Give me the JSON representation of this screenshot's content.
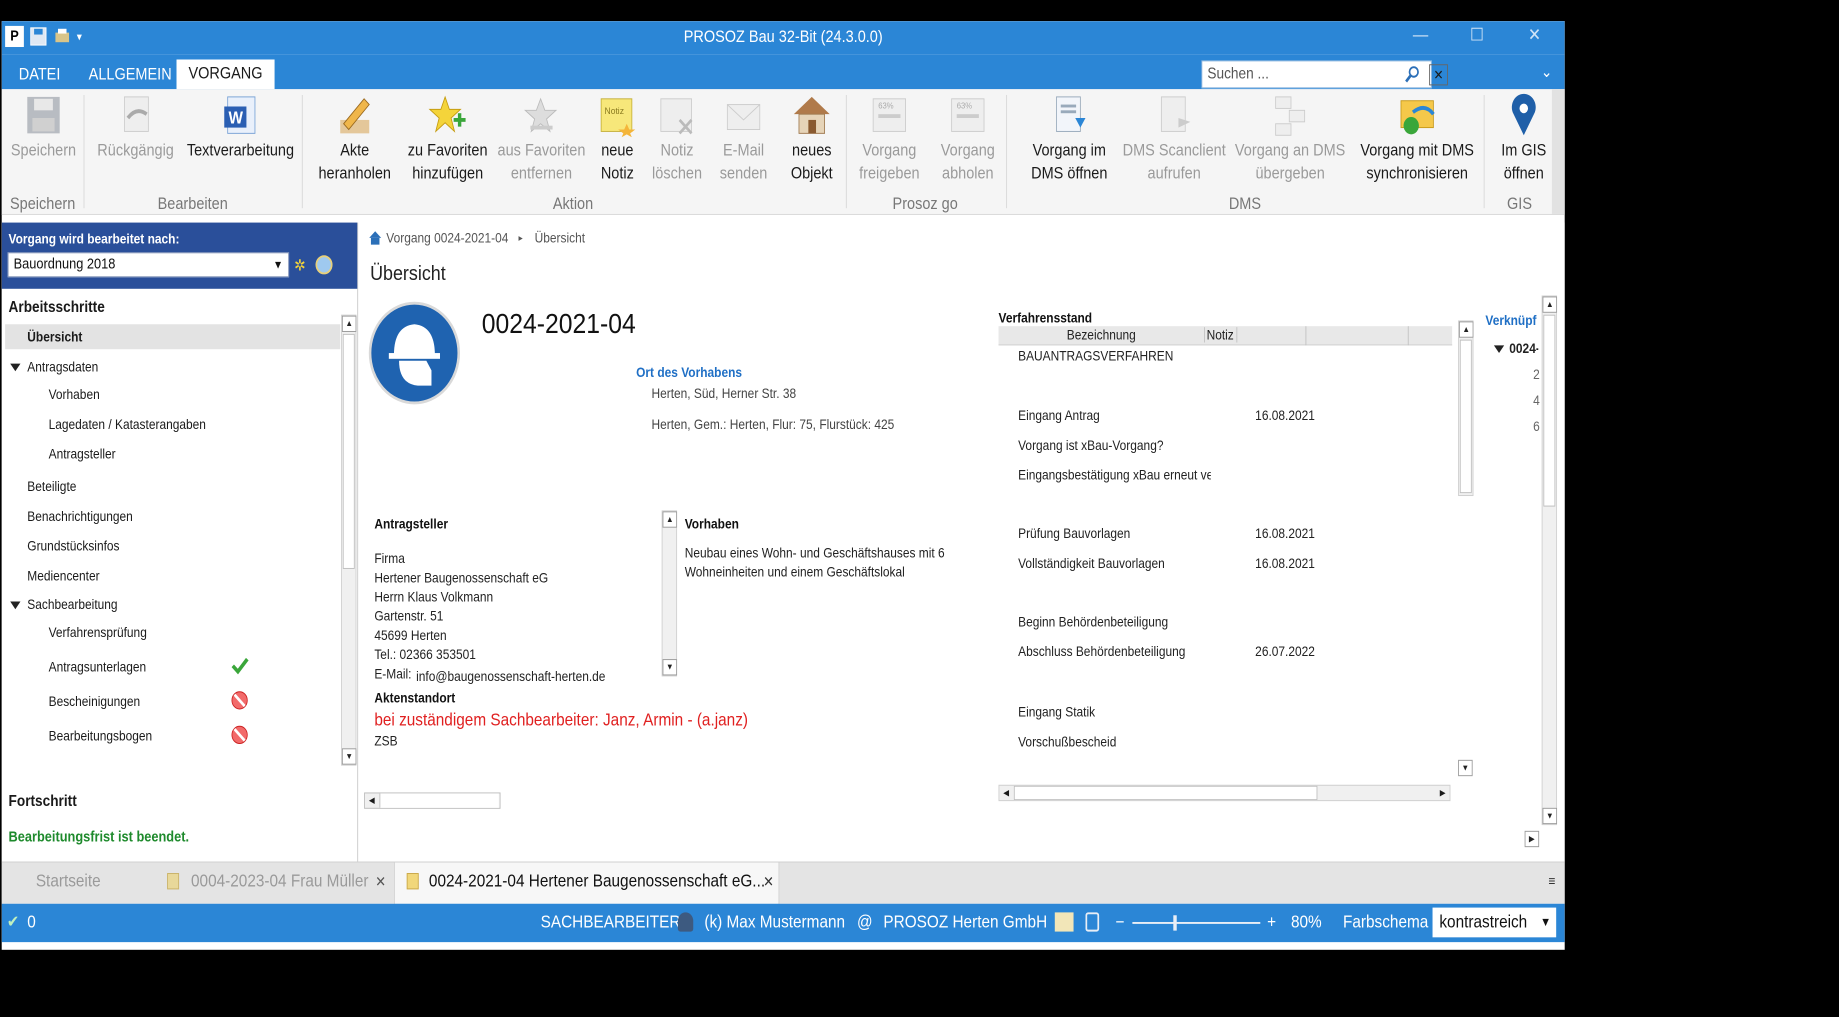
{
  "window": {
    "title": "PROSOZ Bau 32-Bit (24.3.0.0)",
    "app_badge": "P"
  },
  "ribbon_tabs": [
    "DATEI",
    "ALLGEMEIN",
    "VORGANG"
  ],
  "search": {
    "placeholder": "Suchen ..."
  },
  "ribbon": {
    "buttons": [
      {
        "label1": "Speichern",
        "label2": "",
        "icon": "floppy-icon",
        "enabled": false
      },
      {
        "label1": "Rückgängig",
        "label2": "",
        "icon": "undo-icon",
        "enabled": false
      },
      {
        "label1": "Textverarbeitung",
        "label2": "",
        "icon": "word-icon",
        "enabled": true
      },
      {
        "label1": "Akte",
        "label2": "heranholen",
        "icon": "pencil-icon",
        "enabled": true
      },
      {
        "label1": "zu Favoriten",
        "label2": "hinzufügen",
        "icon": "star-add-icon",
        "enabled": true
      },
      {
        "label1": "aus Favoriten",
        "label2": "entfernen",
        "icon": "star-remove-icon",
        "enabled": false
      },
      {
        "label1": "neue",
        "label2": "Notiz",
        "icon": "note-icon",
        "enabled": true
      },
      {
        "label1": "Notiz",
        "label2": "löschen",
        "icon": "note-delete-icon",
        "enabled": false
      },
      {
        "label1": "E-Mail",
        "label2": "senden",
        "icon": "mail-icon",
        "enabled": false
      },
      {
        "label1": "neues",
        "label2": "Objekt",
        "icon": "house-icon",
        "enabled": true
      },
      {
        "label1": "Vorgang",
        "label2": "freigeben",
        "icon": "upload-icon",
        "enabled": false
      },
      {
        "label1": "Vorgang",
        "label2": "abholen",
        "icon": "download-icon",
        "enabled": false
      },
      {
        "label1": "Vorgang im",
        "label2": "DMS öffnen",
        "icon": "dms-open-icon",
        "enabled": true
      },
      {
        "label1": "DMS Scanclient",
        "label2": "aufrufen",
        "icon": "scan-icon",
        "enabled": false
      },
      {
        "label1": "Vorgang an DMS",
        "label2": "übergeben",
        "icon": "dms-transfer-icon",
        "enabled": false
      },
      {
        "label1": "Vorgang mit DMS",
        "label2": "synchronisieren",
        "icon": "sync-icon",
        "enabled": true
      },
      {
        "label1": "Im GIS",
        "label2": "öffnen",
        "icon": "map-pin-icon",
        "enabled": true
      }
    ],
    "groups": [
      "Speichern",
      "Bearbeiten",
      "Aktion",
      "Prosoz go",
      "DMS",
      "GIS"
    ],
    "badge_63": "63%"
  },
  "left": {
    "header": "Vorgang wird bearbeitet nach:",
    "combo_value": "Bauordnung 2018",
    "section_title": "Arbeitsschritte",
    "items": [
      "Übersicht",
      "Antragsdaten",
      "Vorhaben",
      "Lagedaten / Katasterangaben",
      "Antragsteller",
      "Beteiligte",
      "Benachrichtigungen",
      "Grundstücksinfos",
      "Mediencenter",
      "Sachbearbeitung",
      "Verfahrensprüfung",
      "Antragsunterlagen",
      "Bescheinigungen",
      "Bearbeitungsbogen"
    ],
    "progress_title": "Fortschritt",
    "progress_text": "Bearbeitungsfrist ist beendet."
  },
  "main": {
    "breadcrumb": [
      "Vorgang 0024-2021-04",
      "Übersicht"
    ],
    "page_title": "Übersicht",
    "case_number": "0024-2021-04",
    "ort_title": "Ort des Vorhabens",
    "ort_line1": "Herten, Süd, Herner Str. 38",
    "ort_line2": "Herten, Gem.: Herten, Flur: 75, Flurstück: 425",
    "antragsteller_title": "Antragsteller",
    "antragsteller_lines": [
      "Firma",
      "Hertener Baugenossenschaft eG",
      "Herrn Klaus Volkmann",
      "Gartenstr. 51",
      "45699 Herten",
      "Tel.: 02366 353501"
    ],
    "email_label": "E-Mail:",
    "email_value": "info@baugenossenschaft-herten.de",
    "vorhaben_title": "Vorhaben",
    "vorhaben_line1": "Neubau eines Wohn- und Geschäftshauses mit 6",
    "vorhaben_line2": "Wohneinheiten und einem Geschäftslokal",
    "aktenstandort_title": "Aktenstandort",
    "aktenstandort_text": "bei zuständigem Sachbearbeiter: Janz, Armin - (a.janz)",
    "aktenstandort_sub": "ZSB",
    "verfahrensstand": {
      "title": "Verfahrensstand",
      "col_bezeichnung": "Bezeichnung",
      "col_notiz": "Notiz",
      "rows": [
        {
          "name": "BAUANTRAGSVERFAHREN",
          "date": ""
        },
        {
          "name": "Eingang Antrag",
          "date": "16.08.2021"
        },
        {
          "name": "Vorgang ist xBau-Vorgang?",
          "date": ""
        },
        {
          "name": "Eingangsbestätigung xBau erneut ve",
          "date": ""
        },
        {
          "name": "Prüfung  Bauvorlagen",
          "date": "16.08.2021"
        },
        {
          "name": "Vollständigkeit Bauvorlagen",
          "date": "16.08.2021"
        },
        {
          "name": "Beginn Behördenbeteiligung",
          "date": ""
        },
        {
          "name": "Abschluss Behördenbeteiligung",
          "date": "26.07.2022"
        },
        {
          "name": "Eingang Statik",
          "date": ""
        },
        {
          "name": "Vorschußbescheid",
          "date": ""
        }
      ]
    },
    "verknuepf": {
      "title": "Verknüpf",
      "item": "0024-",
      "nums": [
        "2",
        "4",
        "6"
      ]
    }
  },
  "doc_tabs": [
    {
      "label": "Startseite",
      "active": false
    },
    {
      "label": "0004-2023-04 Frau  Müller",
      "active": false
    },
    {
      "label": "0024-2021-04 Hertener Baugenossenschaft eG...",
      "active": true
    }
  ],
  "status": {
    "count": "0",
    "sachbearbeiter_label": "SACHBEARBEITER:",
    "user": "(k) Max Mustermann",
    "at": "@",
    "org": "PROSOZ Herten GmbH",
    "zoom": "80%",
    "farbschema_label": "Farbschema",
    "farbschema_value": "kontrastreich"
  },
  "colors": {
    "title_blue": "#2b86d6",
    "panel_navy": "#2a4f9a",
    "link_blue": "#1f6fc5",
    "alert_red": "#e02020",
    "ok_green": "#1e8a2c"
  }
}
